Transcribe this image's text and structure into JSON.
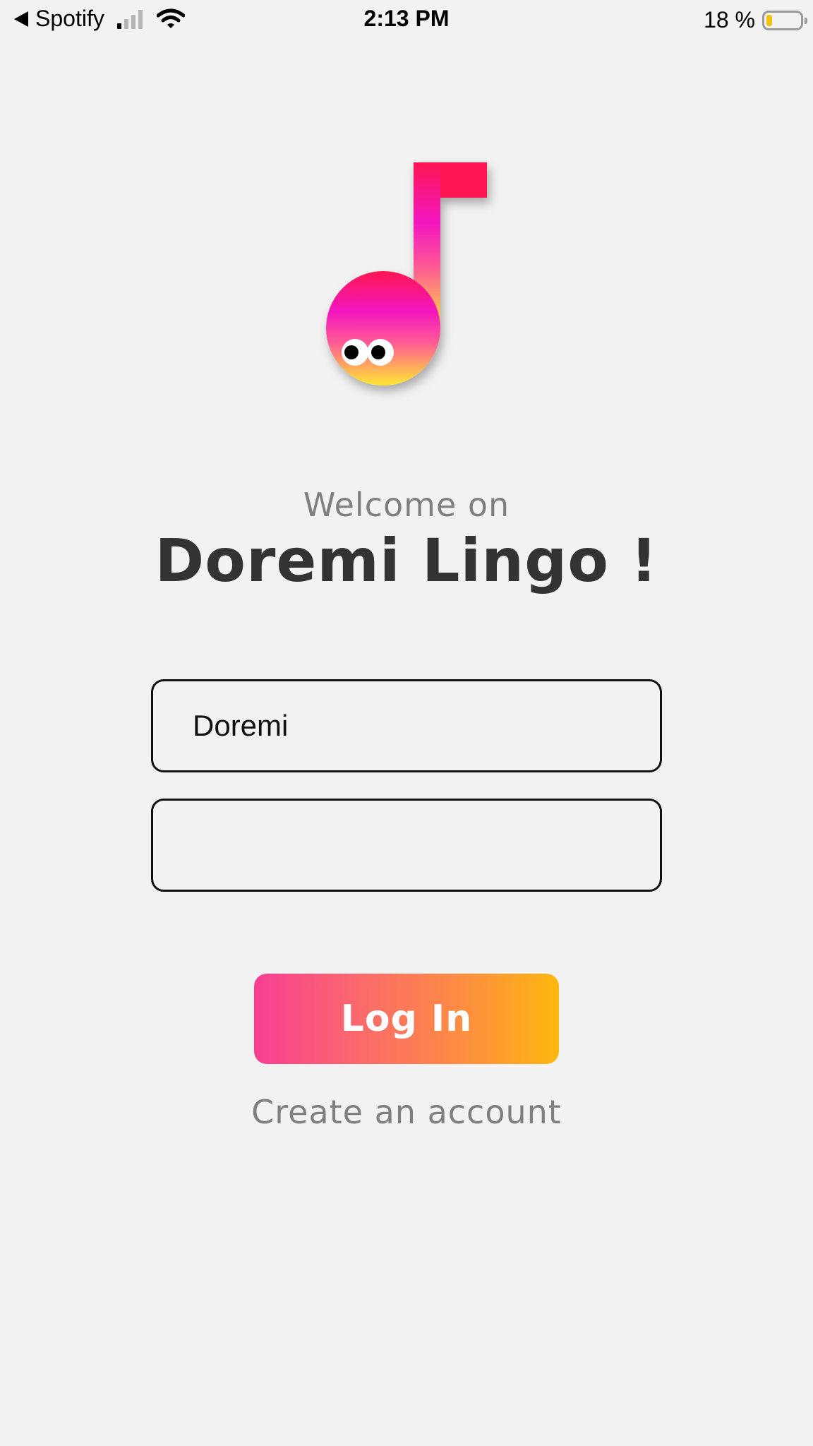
{
  "status_bar": {
    "back_app": "Spotify",
    "time": "2:13 PM",
    "battery_text": "18 %",
    "battery_level": 0.18,
    "signal_strength_bars": 1,
    "icons": [
      "back-arrow-icon",
      "signal-bars-icon",
      "wifi-icon",
      "battery-icon"
    ]
  },
  "logo": {
    "icon": "music-note-mascot-icon",
    "colors": {
      "gradient_top": "#ff1452",
      "gradient_mid": "#f315c0",
      "gradient_bottom": "#ffe832"
    }
  },
  "welcome": {
    "subtitle": "Welcome on",
    "title": "Doremi Lingo !"
  },
  "form": {
    "username_value": "Doremi",
    "username_placeholder": "",
    "password_value": "",
    "password_placeholder": ""
  },
  "actions": {
    "login_label": "Log In",
    "create_account_label": "Create an account",
    "login_gradient": [
      "#f83e93",
      "#feb70e"
    ]
  },
  "colors": {
    "background": "#f2f2f2",
    "title_text": "#333333",
    "secondary_text": "#7f7f7f"
  }
}
